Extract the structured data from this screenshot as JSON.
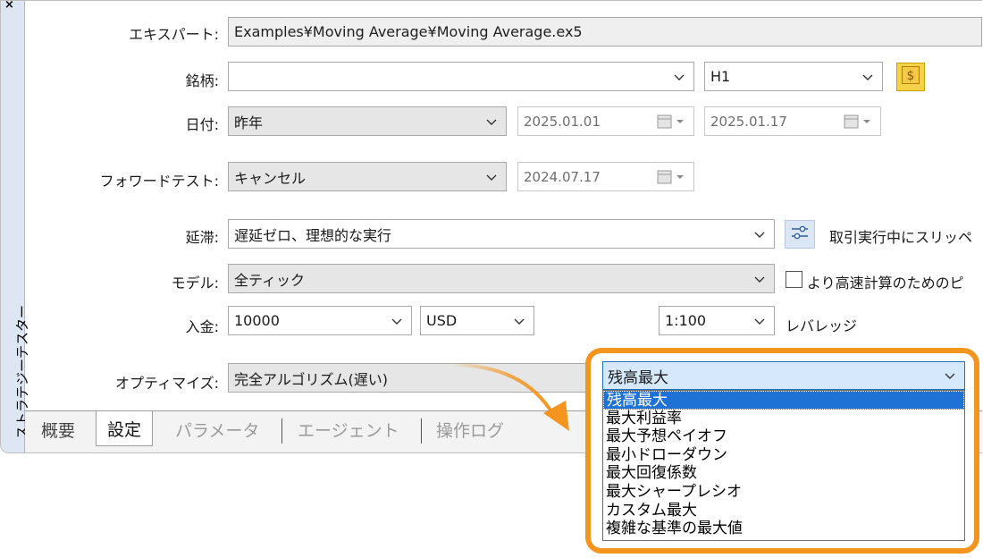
{
  "window": {
    "side_title": "ストラテジーテスター",
    "close_glyph": "×"
  },
  "fields": {
    "expert": {
      "label": "エキスパート:",
      "value": "Examples¥Moving Average¥Moving Average.ex5"
    },
    "symbol": {
      "label": "銘柄:",
      "value": "",
      "timeframe": "H1"
    },
    "date": {
      "label": "日付:",
      "value": "昨年",
      "from": "2025.01.01",
      "to": "2025.01.17"
    },
    "forward": {
      "label": "フォワードテスト:",
      "value": "キャンセル",
      "date": "2024.07.17"
    },
    "delay": {
      "label": "延滞:",
      "value": "遅延ゼロ、理想的な実行",
      "side_text": "取引実行中にスリッペ"
    },
    "model": {
      "label": "モデル:",
      "value": "全ティック",
      "side_text": "より高速計算のためのピ",
      "checkbox_checked": false
    },
    "deposit": {
      "label": "入金:",
      "value": "10000",
      "currency": "USD",
      "leverage": "1:100",
      "leverage_label": "レバレッジ"
    },
    "optimize": {
      "label": "オプティマイズ:",
      "value": "完全アルゴリズム(遅い)"
    }
  },
  "tabs": [
    "概要",
    "設定",
    "パラメータ",
    "エージェント",
    "操作ログ"
  ],
  "active_tab": "設定",
  "dropdown": {
    "selected": "残高最大",
    "options": [
      "残高最大",
      "最大利益率",
      "最大予想ペイオフ",
      "最小ドローダウン",
      "最大回復係数",
      "最大シャープレシオ",
      "カスタム最大",
      "複雑な基準の最大値"
    ]
  },
  "colors": {
    "highlight": "#f3951f",
    "selection": "#1e72d6",
    "side_strip": "#dde6f3",
    "gold_button": "#f4d24a"
  },
  "icons": [
    "chevron-down-icon",
    "calendar-icon",
    "dollar-icon",
    "slippage-settings-icon",
    "close-icon",
    "curved-arrow-icon"
  ]
}
